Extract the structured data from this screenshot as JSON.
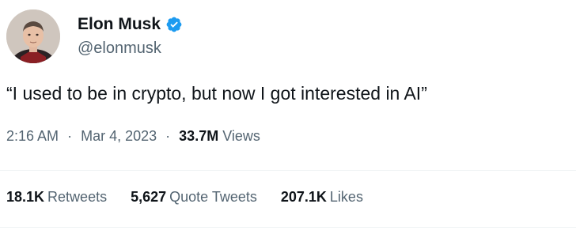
{
  "author": {
    "display_name": "Elon Musk",
    "handle": "@elonmusk",
    "verified_icon": "verified-badge-icon",
    "verified_color": "#1d9bf0"
  },
  "tweet": {
    "text": "“I used to be in crypto, but now I got interested in AI”"
  },
  "meta": {
    "time": "2:16 AM",
    "separator": "·",
    "date": "Mar 4, 2023",
    "views_count": "33.7M",
    "views_label": "Views"
  },
  "stats": {
    "retweets_count": "18.1K",
    "retweets_label": "Retweets",
    "quotes_count": "5,627",
    "quotes_label": "Quote Tweets",
    "likes_count": "207.1K",
    "likes_label": "Likes"
  }
}
